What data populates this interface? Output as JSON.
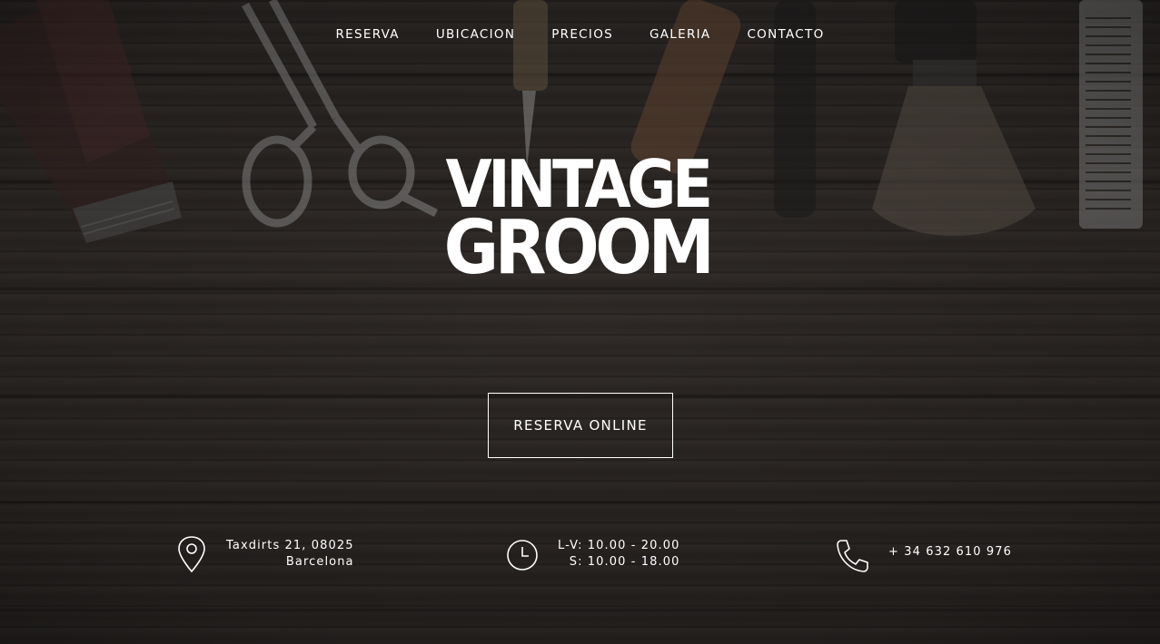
{
  "nav": {
    "items": [
      "RESERVA",
      "UBICACION",
      "PRECIOS",
      "GALERIA",
      "CONTACTO"
    ]
  },
  "logo": {
    "line1": "VINTAGE",
    "line2": "GROOM"
  },
  "cta": {
    "label": "RESERVA ONLINE"
  },
  "info": {
    "address": {
      "icon": "map-pin-icon",
      "line1": "Taxdirts 21, 08025",
      "line2": "Barcelona"
    },
    "hours": {
      "icon": "clock-icon",
      "line1": "L-V: 10.00 - 20.00",
      "line2": "S: 10.00 - 18.00"
    },
    "phone": {
      "icon": "phone-icon",
      "number": "+ 34 632 610 976"
    }
  },
  "background": {
    "image": "barber-tools-on-wooden-table",
    "tools": [
      "hair-clipper-icon",
      "scissors-icon",
      "straight-razor-icon",
      "shaving-brush-icon",
      "comb-icon"
    ]
  }
}
